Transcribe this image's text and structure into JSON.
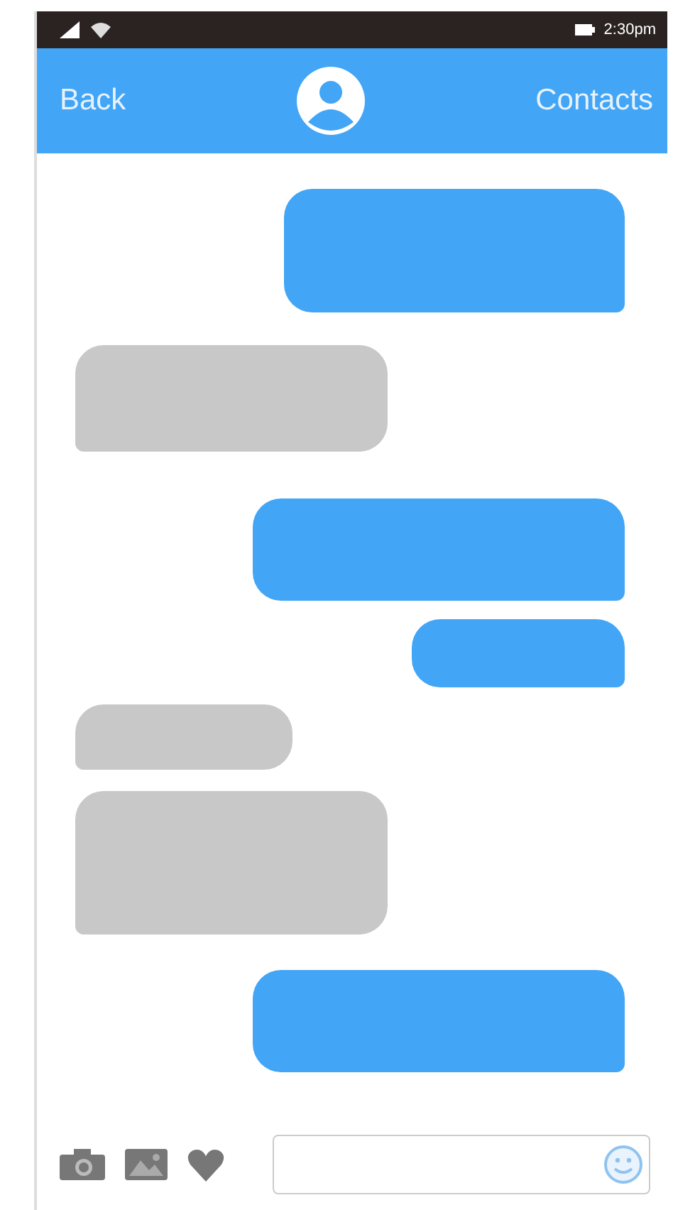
{
  "status_bar": {
    "time": "2:30pm"
  },
  "header": {
    "back": "Back",
    "contacts": "Contacts"
  },
  "messages": [
    {
      "kind": "sent"
    },
    {
      "kind": "received"
    },
    {
      "kind": "sent"
    },
    {
      "kind": "sent"
    },
    {
      "kind": "received"
    },
    {
      "kind": "received"
    },
    {
      "kind": "sent"
    }
  ]
}
